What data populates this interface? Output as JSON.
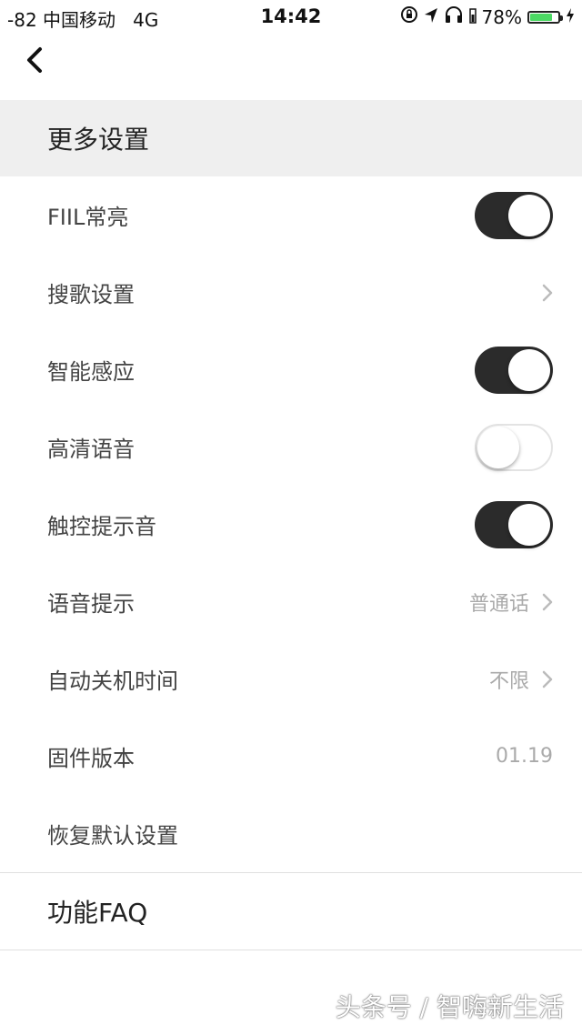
{
  "status_bar": {
    "signal": "-82",
    "carrier": "中国移动",
    "network": "4G",
    "time": "14:42",
    "battery": "78%"
  },
  "header": {
    "section_title": "更多设置"
  },
  "settings": {
    "fiil_on": {
      "label": "FIIL常亮",
      "state": "on"
    },
    "song_search": {
      "label": "搜歌设置"
    },
    "smart_sense": {
      "label": "智能感应",
      "state": "on"
    },
    "hd_voice": {
      "label": "高清语音",
      "state": "off"
    },
    "touch_sound": {
      "label": "触控提示音",
      "state": "on"
    },
    "voice_prompt": {
      "label": "语音提示",
      "value": "普通话"
    },
    "auto_off": {
      "label": "自动关机时间",
      "value": "不限"
    },
    "firmware": {
      "label": "固件版本",
      "value": "01.19"
    },
    "restore": {
      "label": "恢复默认设置"
    }
  },
  "faq": {
    "label": "功能FAQ"
  },
  "watermark": "头条号 / 智嗨新生活",
  "colors": {
    "toggle_on": "#2b2b2b",
    "section_bg": "#efefef",
    "battery": "#4cd964"
  }
}
